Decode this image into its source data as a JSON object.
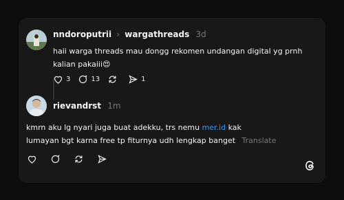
{
  "post": {
    "username": "nndoroputrii",
    "separator": "›",
    "community": "wargathreads",
    "time": "3d",
    "text_line1": "haii warga threads mau dongg rekomen undangan digital yg prnh",
    "text_line2": "kalian pakaiii😍",
    "likes": "3",
    "replies": "13",
    "reposts": "",
    "shares": "1"
  },
  "reply": {
    "username": "rievandrst",
    "time": "1m",
    "text_line1_a": "kmrn aku lg nyari juga buat adekku, trs nemu ",
    "text_line1_link": "mer.id",
    "text_line1_b": " kak",
    "text_line2": "lumayan bgt karna free tp fiturnya udh lengkap banget",
    "translate": "Translate"
  },
  "icons": {
    "like": "heart-icon",
    "reply": "comment-icon",
    "repost": "repost-icon",
    "share": "send-icon",
    "logo": "threads-logo-icon"
  },
  "colors": {
    "background": "#0c0c0c",
    "card": "#181818",
    "text": "#f3f5f7",
    "muted": "#777777",
    "link": "#3897f0"
  }
}
